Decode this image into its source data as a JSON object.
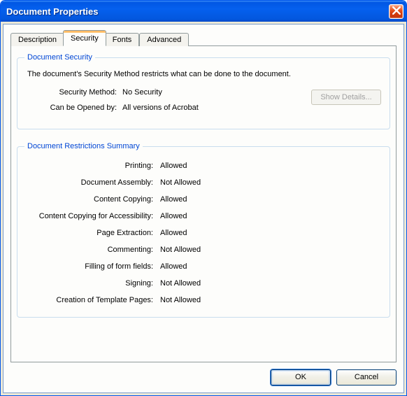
{
  "window": {
    "title": "Document Properties"
  },
  "tabs": {
    "description": "Description",
    "security": "Security",
    "fonts": "Fonts",
    "advanced": "Advanced"
  },
  "security_group": {
    "legend": "Document Security",
    "description": "The document's Security Method restricts what can be done to the document.",
    "method_label": "Security Method:",
    "method_value": "No Security",
    "opened_label": "Can be Opened by:",
    "opened_value": "All versions of Acrobat",
    "show_details": "Show Details..."
  },
  "restrictions_group": {
    "legend": "Document Restrictions Summary",
    "rows": [
      {
        "label": "Printing:",
        "value": "Allowed"
      },
      {
        "label": "Document Assembly:",
        "value": "Not Allowed"
      },
      {
        "label": "Content Copying:",
        "value": "Allowed"
      },
      {
        "label": "Content Copying for Accessibility:",
        "value": "Allowed"
      },
      {
        "label": "Page Extraction:",
        "value": "Allowed"
      },
      {
        "label": "Commenting:",
        "value": "Not Allowed"
      },
      {
        "label": "Filling of form fields:",
        "value": "Allowed"
      },
      {
        "label": "Signing:",
        "value": "Not Allowed"
      },
      {
        "label": "Creation of Template Pages:",
        "value": "Not Allowed"
      }
    ]
  },
  "buttons": {
    "ok": "OK",
    "cancel": "Cancel"
  }
}
